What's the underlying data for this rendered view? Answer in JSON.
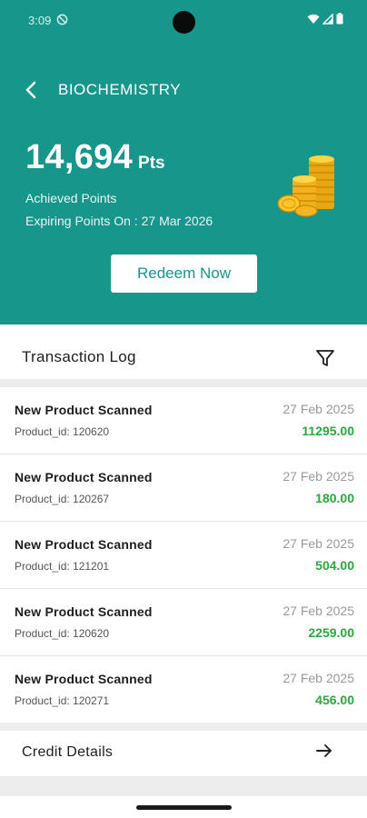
{
  "status_bar": {
    "time": "3:09",
    "icons": [
      "dnd-icon",
      "wifi-icon",
      "signal-icon",
      "battery-icon"
    ]
  },
  "header": {
    "title": "BIOCHEMISTRY",
    "points_value": "14,694",
    "points_unit": "Pts",
    "achieved_label": "Achieved Points",
    "expiring_label": "Expiring Points On : 27 Mar 2026",
    "redeem_label": "Redeem Now",
    "icons": [
      "back-arrow-icon",
      "coins-icon"
    ]
  },
  "transaction_log": {
    "title": "Transaction Log",
    "filter_icon": "filter-icon",
    "items": [
      {
        "title": "New Product Scanned",
        "product_id": "Product_id: 120620",
        "date": "27 Feb 2025",
        "amount": "11295.00"
      },
      {
        "title": "New Product Scanned",
        "product_id": "Product_id: 120267",
        "date": "27 Feb 2025",
        "amount": "180.00"
      },
      {
        "title": "New Product Scanned",
        "product_id": "Product_id: 121201",
        "date": "27 Feb 2025",
        "amount": "504.00"
      },
      {
        "title": "New Product Scanned",
        "product_id": "Product_id: 120620",
        "date": "27 Feb 2025",
        "amount": "2259.00"
      },
      {
        "title": "New Product Scanned",
        "product_id": "Product_id: 120271",
        "date": "27 Feb 2025",
        "amount": "456.00"
      }
    ]
  },
  "credit_details": {
    "label": "Credit Details",
    "icon": "arrow-right-icon"
  },
  "colors": {
    "brand": "#17968c",
    "amount": "#2aa83d",
    "date": "#9a9a9a"
  }
}
